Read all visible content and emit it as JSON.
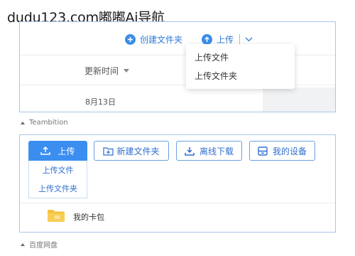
{
  "watermark": "dudu123.com嘟嘟Ai导航",
  "teambition": {
    "toolbar": {
      "create_folder_label": "创建文件夹",
      "upload_label": "上传"
    },
    "column_header": "更新时间",
    "row_date": "8月13日",
    "dropdown_items": [
      "上传文件",
      "上传文件夹"
    ],
    "caption": "Teambition"
  },
  "baidu": {
    "buttons": {
      "upload": "上传",
      "new_folder": "新建文件夹",
      "offline_download": "离线下载",
      "my_devices": "我的设备"
    },
    "dropdown_items": [
      "上传文件",
      "上传文件夹"
    ],
    "file_name": "我的卡包",
    "caption": "百度网盘"
  },
  "colors": {
    "accent": "#3b8ef0",
    "link": "#2f7cd8",
    "panel_border": "#a9c5ec",
    "folder": "#f5c13d"
  }
}
